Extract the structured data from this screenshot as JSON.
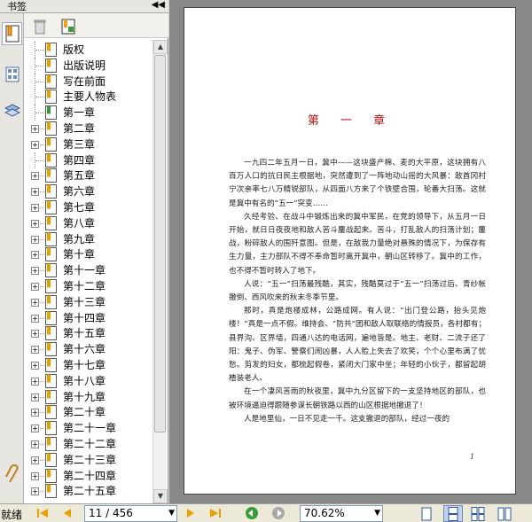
{
  "sidebar": {
    "title": "书签",
    "bookmarks": [
      {
        "label": "版权",
        "expandable": false,
        "green": false
      },
      {
        "label": "出版说明",
        "expandable": false,
        "green": false
      },
      {
        "label": "写在前面",
        "expandable": false,
        "green": false
      },
      {
        "label": "主要人物表",
        "expandable": false,
        "green": false
      },
      {
        "label": "第一章",
        "expandable": false,
        "green": true
      },
      {
        "label": "第二章",
        "expandable": true,
        "green": false
      },
      {
        "label": "第三章",
        "expandable": true,
        "green": false
      },
      {
        "label": "第四章",
        "expandable": false,
        "green": false
      },
      {
        "label": "第五章",
        "expandable": true,
        "green": false
      },
      {
        "label": "第六章",
        "expandable": true,
        "green": false
      },
      {
        "label": "第七章",
        "expandable": true,
        "green": false
      },
      {
        "label": "第八章",
        "expandable": true,
        "green": false
      },
      {
        "label": "第九章",
        "expandable": true,
        "green": false
      },
      {
        "label": "第十章",
        "expandable": true,
        "green": false
      },
      {
        "label": "第十一章",
        "expandable": true,
        "green": false
      },
      {
        "label": "第十二章",
        "expandable": true,
        "green": false
      },
      {
        "label": "第十三章",
        "expandable": true,
        "green": false
      },
      {
        "label": "第十四章",
        "expandable": true,
        "green": false
      },
      {
        "label": "第十五章",
        "expandable": true,
        "green": false
      },
      {
        "label": "第十六章",
        "expandable": true,
        "green": false
      },
      {
        "label": "第十七章",
        "expandable": true,
        "green": false
      },
      {
        "label": "第十八章",
        "expandable": true,
        "green": false
      },
      {
        "label": "第十九章",
        "expandable": true,
        "green": false
      },
      {
        "label": "第二十章",
        "expandable": true,
        "green": false
      },
      {
        "label": "第二十一章",
        "expandable": true,
        "green": false
      },
      {
        "label": "第二十二章",
        "expandable": true,
        "green": false
      },
      {
        "label": "第二十三章",
        "expandable": true,
        "green": false
      },
      {
        "label": "第二十四章",
        "expandable": true,
        "green": false
      },
      {
        "label": "第二十五章",
        "expandable": true,
        "green": false
      }
    ]
  },
  "document": {
    "chapter_title": "第 一 章",
    "paragraphs": [
      "一九四二年五月一日，冀中——这块盛产棉、麦的大平原，这块拥有八百万人口的抗日民主根据地，突然遭到了一阵地动山摇的大风暴：敌酋冈村宁次亲率七八万精锐部队，从四面八方来了个铁壁合围，轮番大扫荡。这就是冀中有名的“五一”突变……",
      "久经考验、在战斗中锻炼出来的冀中军民，在党的领导下，从五月一日开始，就日日夜夜地和敌人苦斗鏖战起来。苦斗，打乱敌人的扫荡计划；鏖战，粉碎敌人的围歼意图。但是，在敌我力量绝对悬殊的情况下，为保存有生力量，主力部队不得不奉命暂时离开冀中，朝山区转移了。冀中的工作，也不得不暂时转入了地下。",
      "人说：“五一”扫荡最残酷，其实，残酷莫过于“五一”扫荡过后、青纱帐撤倒、西风吹来的秋末冬季节里。",
      "那时，真是炮楼成林，公路成网。有人说：“出门登公路，抬头见炮楼！”真是一点不假。维持会、“防共”团和敌人取联络的情报员，各村都有；县界沟、区界墙，四通八达的电话网，遍地皆是。地主、老财、二流子还了阳：鬼子、伪军、警察们闹凶暴，人人脸上失去了欢笑，个个心里布满了忧愁。剪发的妇女，都梳起假卷，紧闭大门家中坐；年轻的小伙子，都留起胡楂装老人。",
      "在一个凄风苦雨的秋夜里，冀中九分区留下的一支坚持地区的部队，也被环境逼迫得跟随参谋长朝铁路以西的山区根据地撤退了！",
      "人是地里仙，一日不见走一千。这支撤退的部队，经过一夜的"
    ],
    "page_number": "1"
  },
  "status": {
    "text": "就绪",
    "page_field": "11 / 456",
    "zoom_field": "70.62%"
  },
  "colors": {
    "chapter": "#b01010",
    "nav_arrow": "#e8a000",
    "green_nav": "#3a9a3a"
  }
}
